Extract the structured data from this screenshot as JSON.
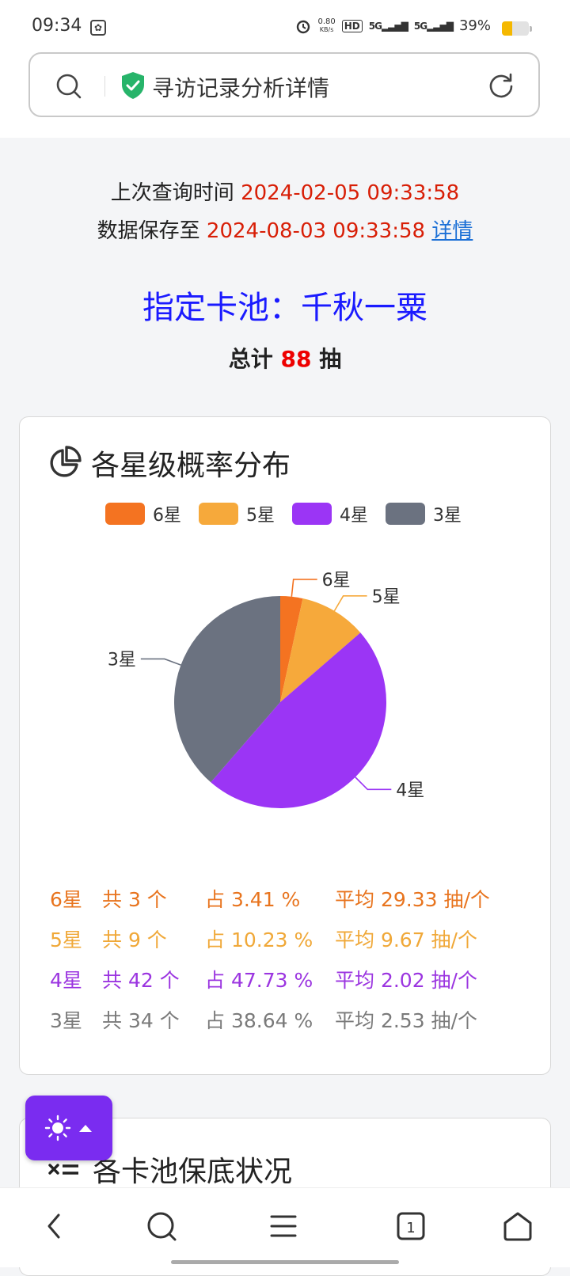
{
  "status_bar": {
    "time": "09:34",
    "net_speed_value": "0.80",
    "net_speed_unit": "KB/s",
    "hd": "HD",
    "sim1": "5G",
    "sim2": "5G",
    "battery": "39%",
    "battery_level": 0.39
  },
  "browser": {
    "page_title": "寻访记录分析详情"
  },
  "meta": {
    "last_query_label": "上次查询时间",
    "last_query_time": "2024-02-05 09:33:58",
    "saved_until_label": "数据保存至",
    "saved_until_time": "2024-08-03 09:33:58",
    "details_link": "详情"
  },
  "pool": {
    "title": "指定卡池：千秋一粟",
    "total_prefix": "总计",
    "total_count": "88",
    "total_suffix": "抽"
  },
  "distribution_card": {
    "title": "各星级概率分布",
    "colors": {
      "6星": "#f47321",
      "5星": "#f6a93b",
      "4星": "#9b35f5",
      "3星": "#6b7280"
    },
    "stats": [
      {
        "star": "6星",
        "count": "共 3 个",
        "pct": "占 3.41 %",
        "avg": "平均 29.33 抽/个",
        "color": "#e8741e"
      },
      {
        "star": "5星",
        "count": "共 9 个",
        "pct": "占 10.23 %",
        "avg": "平均 9.67 抽/个",
        "color": "#f0a838"
      },
      {
        "star": "4星",
        "count": "共 42 个",
        "pct": "占 47.73 %",
        "avg": "平均 2.02 抽/个",
        "color": "#9b35e0"
      },
      {
        "star": "3星",
        "count": "共 34 个",
        "pct": "占 38.64 %",
        "avg": "平均 2.53 抽/个",
        "color": "#7a7a7a"
      }
    ]
  },
  "chart_data": {
    "type": "pie",
    "categories": [
      "6星",
      "5星",
      "4星",
      "3星"
    ],
    "values": [
      3,
      9,
      42,
      34
    ],
    "legend_position": "top",
    "colors": [
      "#f47321",
      "#f6a93b",
      "#9b35f5",
      "#6b7280"
    ]
  },
  "guarantee_card": {
    "title": "各卡池保底状况"
  }
}
